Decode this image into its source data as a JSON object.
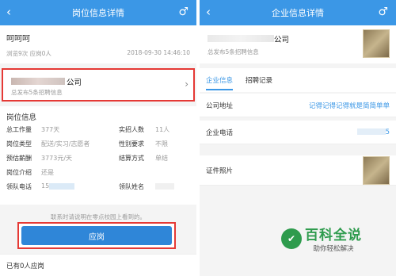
{
  "left": {
    "header": {
      "title": "岗位信息详情",
      "back_icon": "chevron-left-icon",
      "gender_icon": "male-icon"
    },
    "job": {
      "title": "呵呵呵",
      "stats": "浏览9次 应岗0人",
      "date": "2018-09-30 14:46:10"
    },
    "company": {
      "name_suffix": "公司",
      "posts": "总发布5条招聘信息"
    },
    "info": {
      "section": "岗位信息",
      "rows": [
        {
          "k1": "总工作量",
          "v1": "377天",
          "k2": "实招人数",
          "v2": "11人"
        },
        {
          "k1": "岗位类型",
          "v1": "配送/实习/志愿者",
          "k2": "性别要求",
          "v2": "不限"
        },
        {
          "k1": "预估薪酬",
          "v1": "3773元/天",
          "k2": "结算方式",
          "v2": "单结"
        },
        {
          "k1": "岗位介绍",
          "v1": "还是"
        },
        {
          "k1": "领队电话",
          "v1": "15",
          "k2": "领队姓名",
          "v2": ""
        }
      ]
    },
    "notice": "联系时请说明在零点校园上看到的。",
    "apply_button": "应岗",
    "applied": "已有0人应岗"
  },
  "right": {
    "header": {
      "title": "企业信息详情",
      "back_icon": "chevron-left-icon",
      "gender_icon": "male-icon"
    },
    "company": {
      "name_suffix": "公司",
      "posts": "总发布5条招聘信息"
    },
    "tabs": [
      "企业信息",
      "招聘记录"
    ],
    "address": {
      "label": "公司地址",
      "value": "记得记得记得就是简简单单"
    },
    "phone": {
      "label": "企业电话",
      "value": "5"
    },
    "license": {
      "label": "证件照片"
    }
  },
  "watermark": {
    "title": "百科全说",
    "subtitle": "助你轻松解决"
  },
  "colors": {
    "primary": "#3b97e6",
    "highlight": "#e53935",
    "watermark": "#2e9b4d"
  }
}
